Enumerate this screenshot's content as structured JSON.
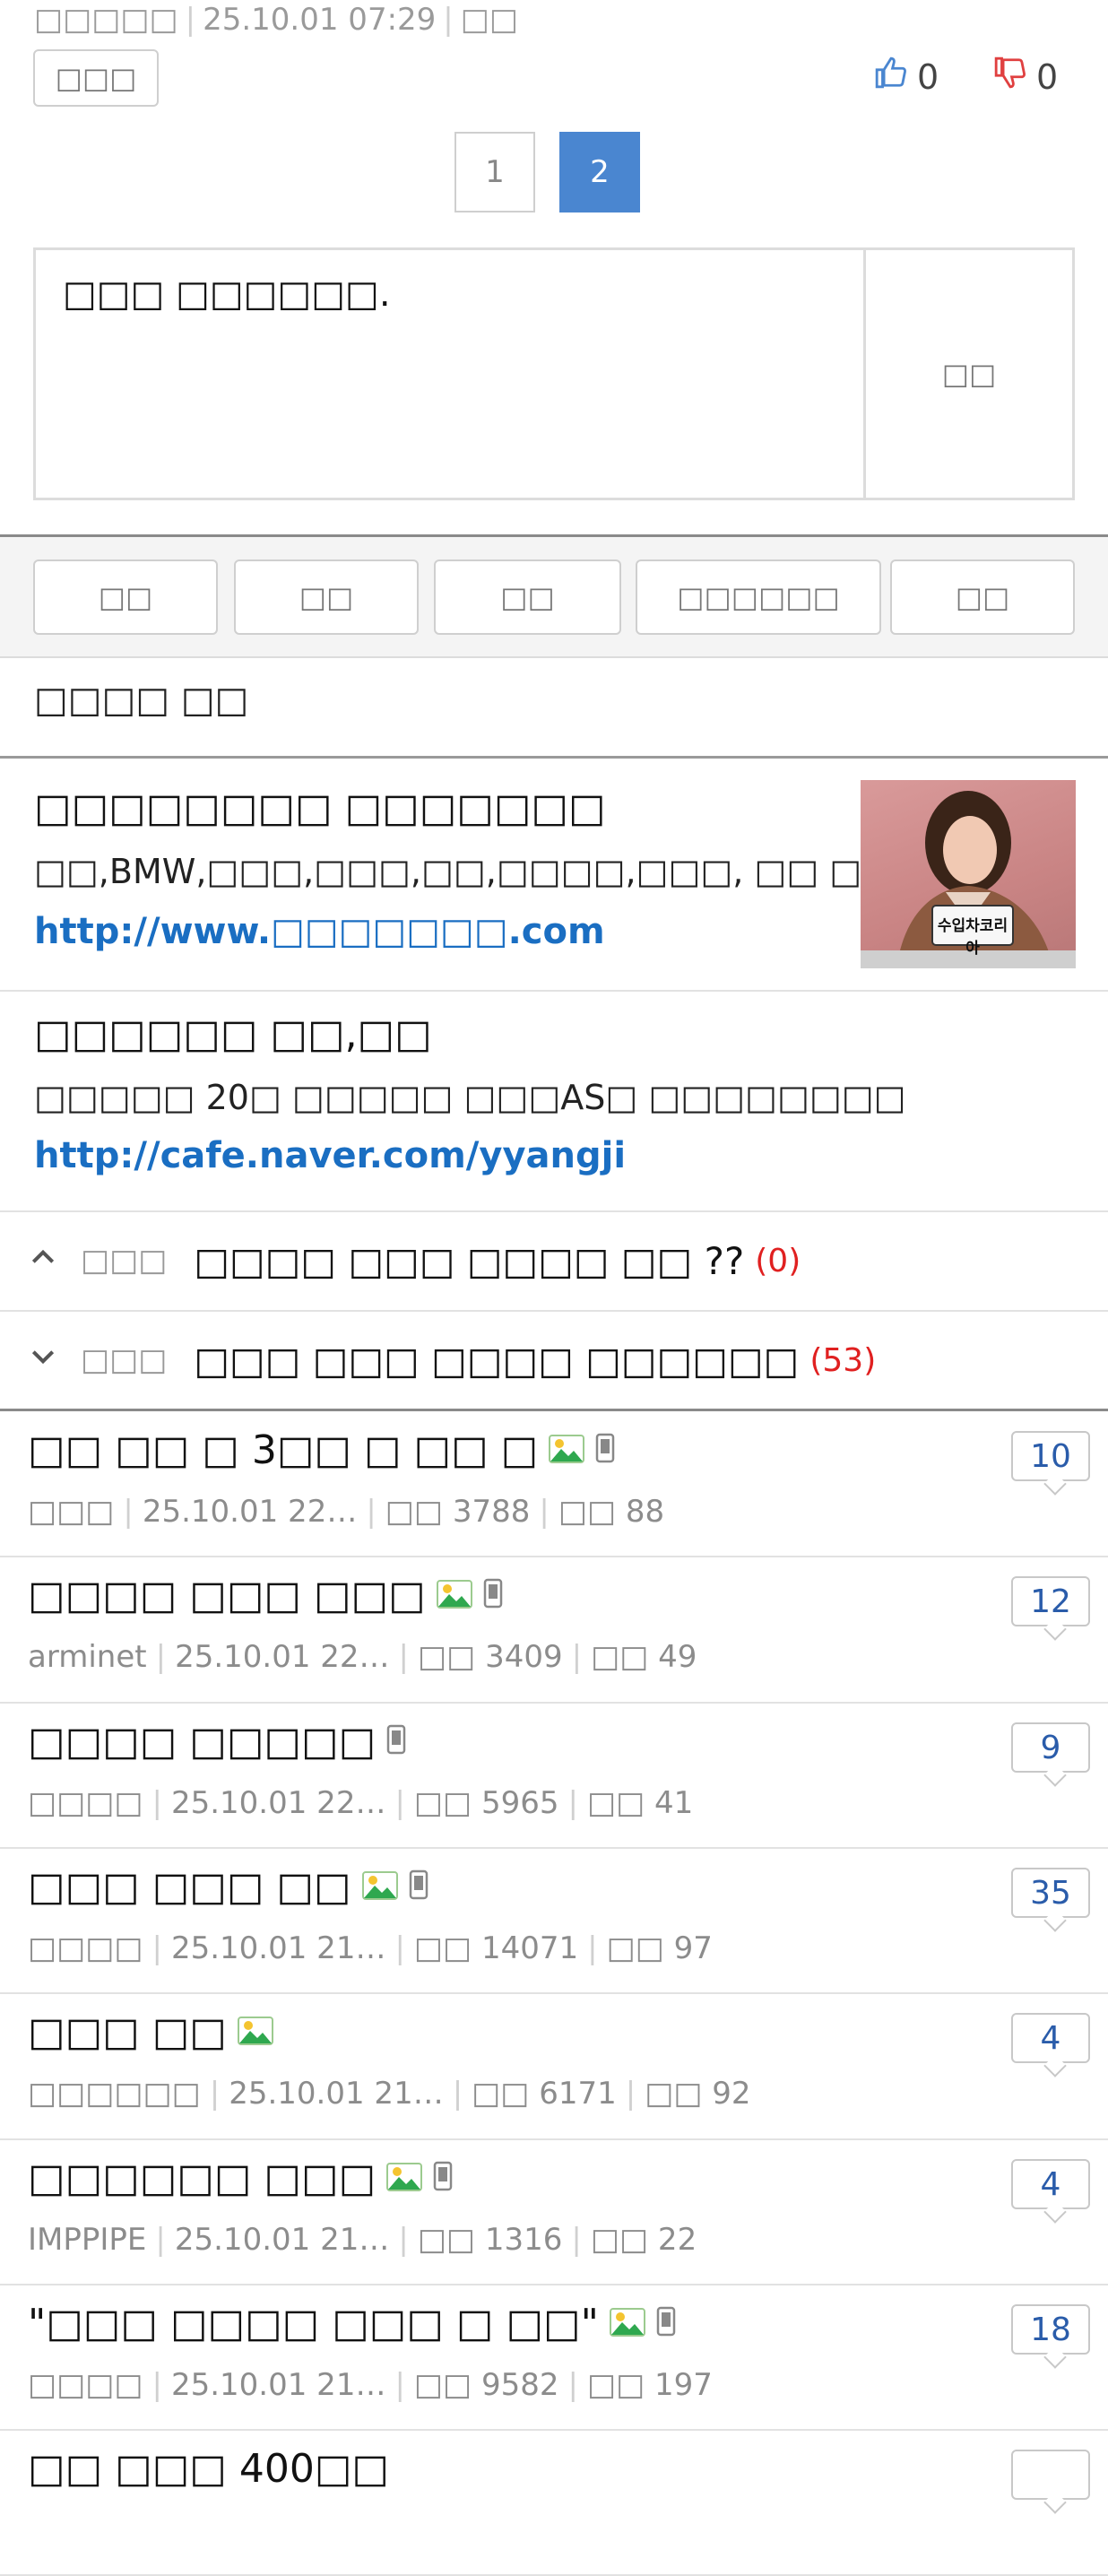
{
  "header": {
    "author": "□□□□□",
    "datetime": "25.10.01  07:29",
    "extra": "□□",
    "report_label": "□□□",
    "likes": "0",
    "dislikes": "0"
  },
  "pager": {
    "pages": [
      "1",
      "2"
    ],
    "current": "2"
  },
  "comment": {
    "placeholder": "□□□  □□□□□□.",
    "submit_label": "□□"
  },
  "toolbar": {
    "buttons": [
      "□□",
      "□□",
      "□□",
      "□□□□□□",
      "□□"
    ]
  },
  "section_title": "□□□□ □□",
  "ads": [
    {
      "title": "□□□□□□□□ □□□□□□□",
      "desc": "□□,BMW,□□□,□□□,□□,□□□□,□□□, □□ □...",
      "link": "http://www.□□□□□□□.com",
      "image_caption": "수입차코리아"
    },
    {
      "title": "□□□□□□ □□,□□",
      "desc": "□□□□□ 20□ □□□□□ □□□AS□ □□□□□□□□",
      "link": "http://cafe.naver.com/yyangji"
    }
  ],
  "nav": [
    {
      "icon": "chevron-up-icon",
      "label": "□□□",
      "title": "□□□□ □□□ □□□□ □□ ??",
      "count": "(0)"
    },
    {
      "icon": "chevron-down-icon",
      "label": "□□□",
      "title": "□□□ □□□ □□□□ □□□□□□",
      "count": "(53)"
    }
  ],
  "posts": [
    {
      "title": "□□ □□ □ 3□□ □ □□ □",
      "image": true,
      "mobile": true,
      "author": "□□□",
      "date": "25.10.01  22…",
      "views": "□□ 3788",
      "likes": "□□ 88",
      "comments": "10"
    },
    {
      "title": "□□□□ □□□ □□□",
      "image": true,
      "mobile": true,
      "author": "arminet",
      "date": "25.10.01  22…",
      "views": "□□ 3409",
      "likes": "□□ 49",
      "comments": "12"
    },
    {
      "title": "□□□□ □□□□□",
      "image": false,
      "mobile": true,
      "author": "□□□□",
      "date": "25.10.01  22…",
      "views": "□□ 5965",
      "likes": "□□ 41",
      "comments": "9"
    },
    {
      "title": "□□□ □□□ □□",
      "image": true,
      "mobile": true,
      "author": "□□□□",
      "date": "25.10.01  21…",
      "views": "□□ 14071",
      "likes": "□□ 97",
      "comments": "35"
    },
    {
      "title": "□□□ □□",
      "image": true,
      "mobile": false,
      "author": "□□□□□□",
      "date": "25.10.01  21…",
      "views": "□□ 6171",
      "likes": "□□ 92",
      "comments": "4"
    },
    {
      "title": "□□□□□□ □□□",
      "image": true,
      "mobile": true,
      "author": "IMPPIPE",
      "date": "25.10.01  21…",
      "views": "□□ 1316",
      "likes": "□□ 22",
      "comments": "4"
    },
    {
      "title": "\"□□□ □□□□ □□□ □ □□\"",
      "image": true,
      "mobile": true,
      "author": "□□□□",
      "date": "25.10.01  21…",
      "views": "□□ 9582",
      "likes": "□□ 197",
      "comments": "18"
    },
    {
      "title": "□□ □□□ 400□□",
      "image": false,
      "mobile": false,
      "author": "",
      "date": "",
      "views": "",
      "likes": "",
      "comments": ""
    }
  ],
  "colors": {
    "accent": "#4a86d0",
    "link": "#1a6ec2",
    "count_red": "#e02020",
    "badge_text": "#2a5caa"
  }
}
